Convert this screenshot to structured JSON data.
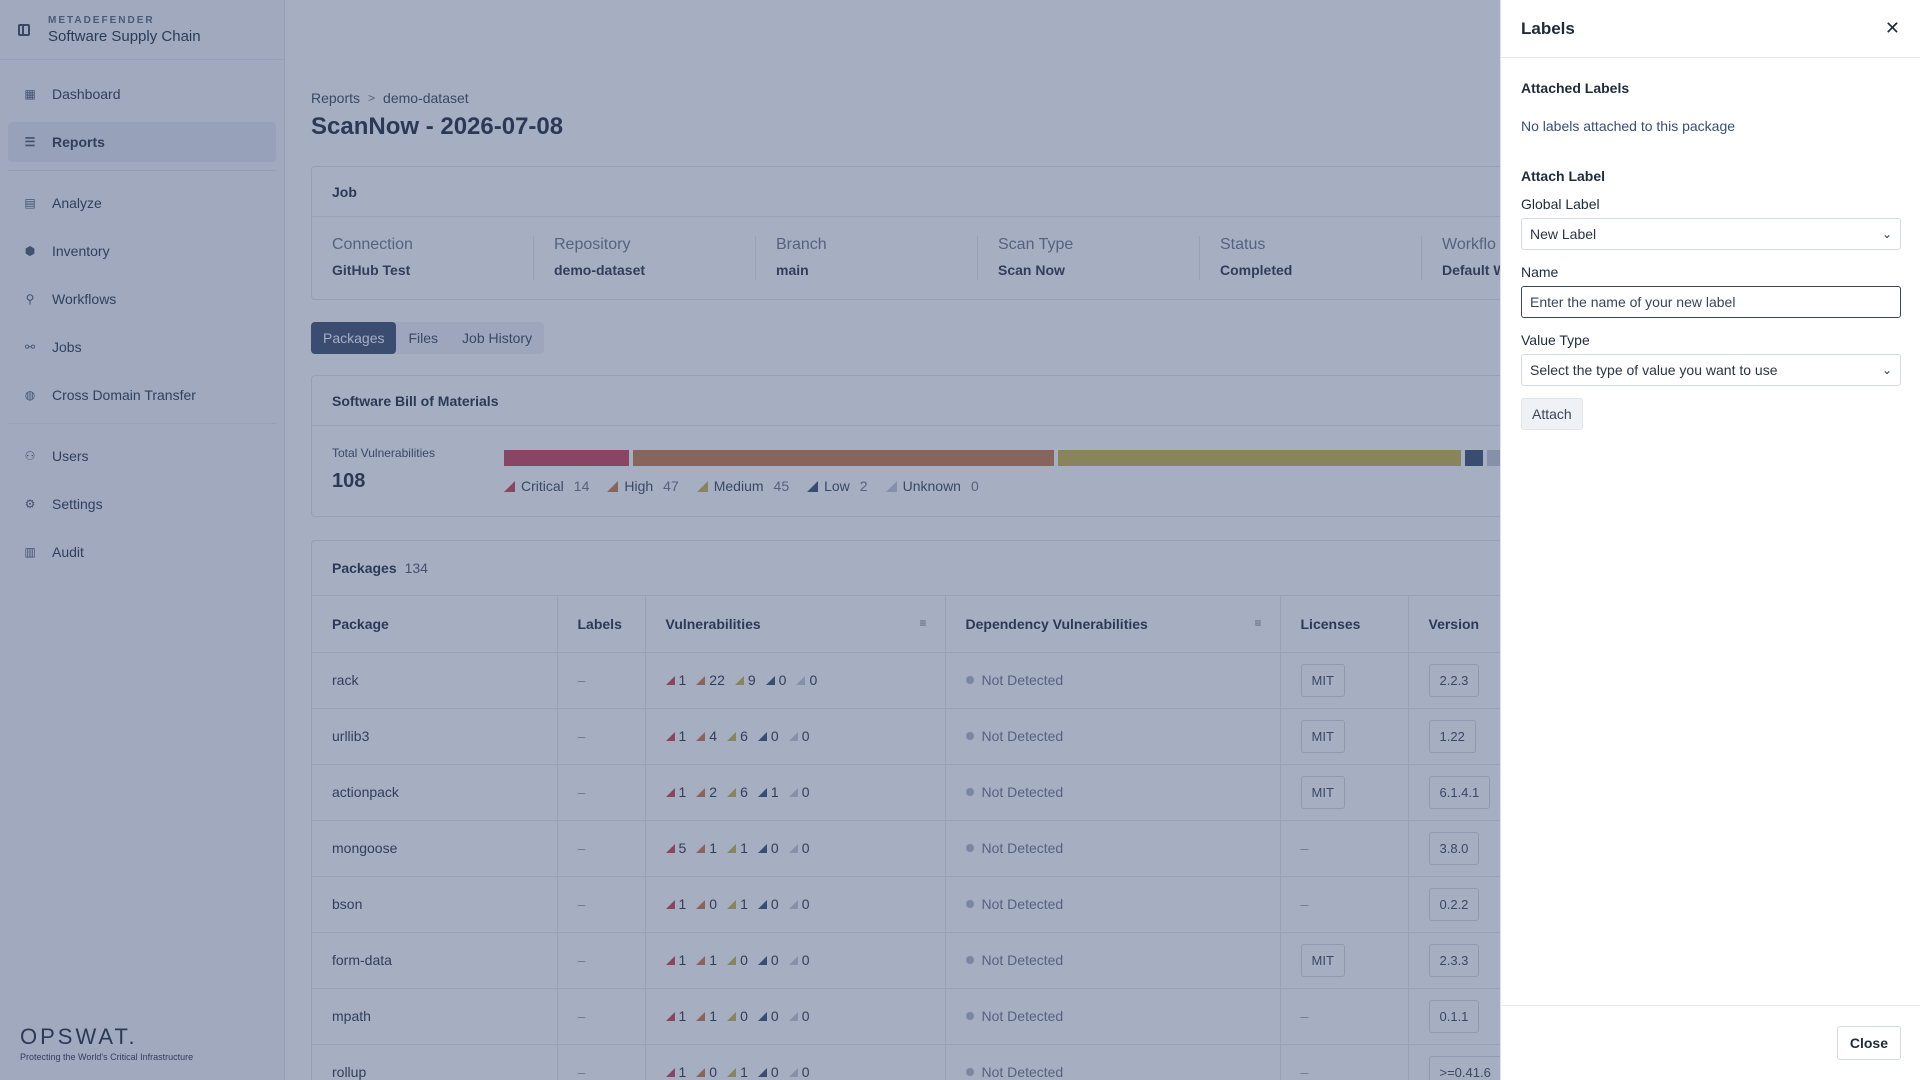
{
  "brand": {
    "small": "METADEFENDER",
    "big": "Software Supply Chain"
  },
  "nav": [
    {
      "label": "Dashboard",
      "icon": "▦",
      "active": false
    },
    {
      "label": "Reports",
      "icon": "☰",
      "active": true
    },
    {
      "label": "Analyze",
      "icon": "▤",
      "active": false
    },
    {
      "label": "Inventory",
      "icon": "⬢",
      "active": false
    },
    {
      "label": "Workflows",
      "icon": "⚲",
      "active": false
    },
    {
      "label": "Jobs",
      "icon": "⚯",
      "active": false
    },
    {
      "label": "Cross Domain Transfer",
      "icon": "◍",
      "active": false
    },
    {
      "label": "Users",
      "icon": "⚇",
      "active": false
    },
    {
      "label": "Settings",
      "icon": "⚙",
      "active": false
    },
    {
      "label": "Audit",
      "icon": "▥",
      "active": false
    }
  ],
  "logo": {
    "word": "OPSWAT.",
    "tagline": "Protecting the World's Critical Infrastructure"
  },
  "breadcrumb": {
    "root": "Reports",
    "current": "demo-dataset"
  },
  "page_title": "ScanNow - 2026-07-08",
  "job": {
    "title": "Job",
    "fields": [
      {
        "k": "Connection",
        "v": "GitHub Test"
      },
      {
        "k": "Repository",
        "v": "demo-dataset"
      },
      {
        "k": "Branch",
        "v": "main"
      },
      {
        "k": "Scan Type",
        "v": "Scan Now"
      },
      {
        "k": "Status",
        "v": "Completed"
      },
      {
        "k": "Workflo",
        "v": "Default W"
      }
    ]
  },
  "tabs": [
    "Packages",
    "Files",
    "Job History"
  ],
  "sbom": {
    "title": "Software Bill of Materials",
    "total_label": "Total Vulnerabilities",
    "total_value": "108",
    "severities": [
      {
        "name": "Critical",
        "count": 14,
        "color": "#c94056"
      },
      {
        "name": "High",
        "count": 47,
        "color": "#c87948"
      },
      {
        "name": "Medium",
        "count": 45,
        "color": "#c9b54a"
      },
      {
        "name": "Low",
        "count": 2,
        "color": "#3c4d6e"
      },
      {
        "name": "Unknown",
        "count": 0,
        "color": "#c3c9d4"
      }
    ]
  },
  "packages": {
    "title": "Packages",
    "count": "134",
    "columns": [
      "Package",
      "Labels",
      "Vulnerabilities",
      "Dependency Vulnerabilities",
      "Licenses",
      "Version"
    ],
    "rows": [
      {
        "name": "rack",
        "labels": "–",
        "v": [
          1,
          22,
          9,
          0,
          0
        ],
        "dep": "Not Detected",
        "license": "MIT",
        "version": "2.2.3"
      },
      {
        "name": "urllib3",
        "labels": "–",
        "v": [
          1,
          4,
          6,
          0,
          0
        ],
        "dep": "Not Detected",
        "license": "MIT",
        "version": "1.22"
      },
      {
        "name": "actionpack",
        "labels": "–",
        "v": [
          1,
          2,
          6,
          1,
          0
        ],
        "dep": "Not Detected",
        "license": "MIT",
        "version": "6.1.4.1"
      },
      {
        "name": "mongoose",
        "labels": "–",
        "v": [
          5,
          1,
          1,
          0,
          0
        ],
        "dep": "Not Detected",
        "license": "–",
        "version": "3.8.0"
      },
      {
        "name": "bson",
        "labels": "–",
        "v": [
          1,
          0,
          1,
          0,
          0
        ],
        "dep": "Not Detected",
        "license": "–",
        "version": "0.2.2"
      },
      {
        "name": "form-data",
        "labels": "–",
        "v": [
          1,
          1,
          0,
          0,
          0
        ],
        "dep": "Not Detected",
        "license": "MIT",
        "version": "2.3.3"
      },
      {
        "name": "mpath",
        "labels": "–",
        "v": [
          1,
          1,
          0,
          0,
          0
        ],
        "dep": "Not Detected",
        "license": "–",
        "version": "0.1.1"
      },
      {
        "name": "rollup",
        "labels": "–",
        "v": [
          1,
          0,
          1,
          0,
          0
        ],
        "dep": "Not Detected",
        "license": "–",
        "version": ">=0.41.6"
      }
    ]
  },
  "drawer": {
    "title": "Labels",
    "attached_title": "Attached Labels",
    "empty_text": "No labels attached to this package",
    "attach_title": "Attach Label",
    "global_label_label": "Global Label",
    "global_label_value": "New Label",
    "name_label": "Name",
    "name_placeholder": "Enter the name of your new label",
    "value_type_label": "Value Type",
    "value_type_value": "Select the type of value you want to use",
    "attach_button": "Attach",
    "close_button": "Close"
  }
}
